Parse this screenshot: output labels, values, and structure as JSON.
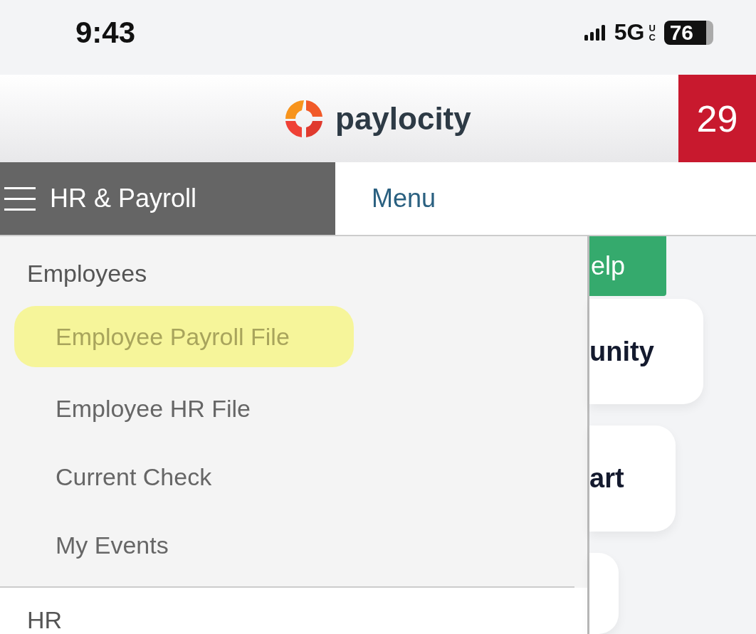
{
  "status_bar": {
    "time": "9:43",
    "network": "5G",
    "network_sub": "UC",
    "battery": "76"
  },
  "header": {
    "logo_text": "paylocity",
    "badge": "29"
  },
  "nav": {
    "section": "HR & Payroll",
    "menu": "Menu"
  },
  "side_menu": {
    "groups": [
      {
        "title": "Employees",
        "items": [
          {
            "label": "Employee Payroll File",
            "highlighted": true
          },
          {
            "label": "Employee HR File",
            "highlighted": false
          },
          {
            "label": "Current Check",
            "highlighted": false
          },
          {
            "label": "My Events",
            "highlighted": false
          }
        ]
      },
      {
        "title": "HR"
      }
    ]
  },
  "background": {
    "button": "elp",
    "cards": [
      {
        "kind": "titled",
        "title": "unity"
      },
      {
        "kind": "titled",
        "title": "art"
      },
      {
        "kind": "blank"
      }
    ]
  }
}
